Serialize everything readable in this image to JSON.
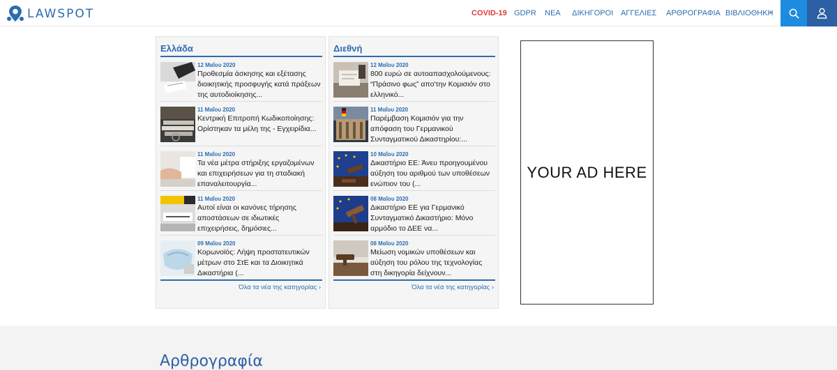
{
  "brand": {
    "name": "LAWSPOT"
  },
  "nav": {
    "items": [
      "COVID-19",
      "GDPR",
      "ΝΕΑ",
      "ΔΙΚΗΓΟΡΟΙ",
      "ΑΓΓΕΛΙΕΣ",
      "ΑΡΘΡΟΓΡΑΦΙΑ",
      "ΒΙΒΛΙΟΘΗΚΗ"
    ],
    "arrow": "›",
    "search_icon": "search-icon",
    "user_icon": "user-icon"
  },
  "panels": {
    "greece": {
      "title": "Ελλάδα",
      "more": "Όλα τα νέα της κατηγορίας ›",
      "items": [
        {
          "date": "12 Μαΐου 2020",
          "headline": "Προθεσμία άσκησης και εξέτασης διοικητικής προσφυγής κατά πράξεων της αυτοδιοίκησης..."
        },
        {
          "date": "11 Μαΐου 2020",
          "headline": "Κεντρική Επιτροπή Κωδικοποίησης: Ορίστηκαν τα μέλη της - Εγχειρίδια..."
        },
        {
          "date": "11 Μαΐου 2020",
          "headline": "Τα νέα μέτρα στήριξης εργαζομένων και επιχειρήσεων για τη σταδιακή επαναλειτουργία..."
        },
        {
          "date": "11 Μαΐου 2020",
          "headline": "Αυτοί είναι οι κανόνες τήρησης αποστάσεων σε ιδιωτικές επιχειρήσεις, δημόσιες..."
        },
        {
          "date": "09 Μαΐου 2020",
          "headline": "Κορωνοϊός: Λήψη προστατευτικών μέτρων στο ΣτΕ και τα Διοικητικά Δικαστήρια (..."
        }
      ]
    },
    "international": {
      "title": "Διεθνή",
      "more": "Όλα τα νέα της κατηγορίας ›",
      "items": [
        {
          "date": "12 Μαΐου 2020",
          "headline": "800 ευρώ σε αυτοαπασχολούμενους: “Πράσινο φως” απο'την Κομισιόν στο ελληνικό..."
        },
        {
          "date": "11 Μαΐου 2020",
          "headline": "Παρέμβαση Κομισιόν για την απόφαση του Γερμανικού Συνταγματικού Δικαστηρίου:..."
        },
        {
          "date": "10 Μαΐου 2020",
          "headline": "Δικαστήριο ΕΕ: Άνευ προηγουμένου αύξηση του αριθμού των υποθέσεων ενώπιον του (..."
        },
        {
          "date": "08 Μαΐου 2020",
          "headline": "Δικαστήριο ΕΕ για Γερμανικό Συνταγματικό Δικαστήριο: Μόνο αρμόδιο το ΔΕΕ να..."
        },
        {
          "date": "08 Μαΐου 2020",
          "headline": "Μείωση νομικών υποθέσεων και αύξηση του ρόλου της τεχνολογίας στη δικηγορία δείχνουν..."
        }
      ]
    }
  },
  "ad": {
    "text": "YOUR AD HERE"
  },
  "section": {
    "heading": "Αρθρογραφία"
  },
  "colors": {
    "brand_blue": "#2c6cb0",
    "covid_red": "#e03a3a",
    "search_bg": "#1d8ce0",
    "user_bg": "#2c5fa3"
  }
}
